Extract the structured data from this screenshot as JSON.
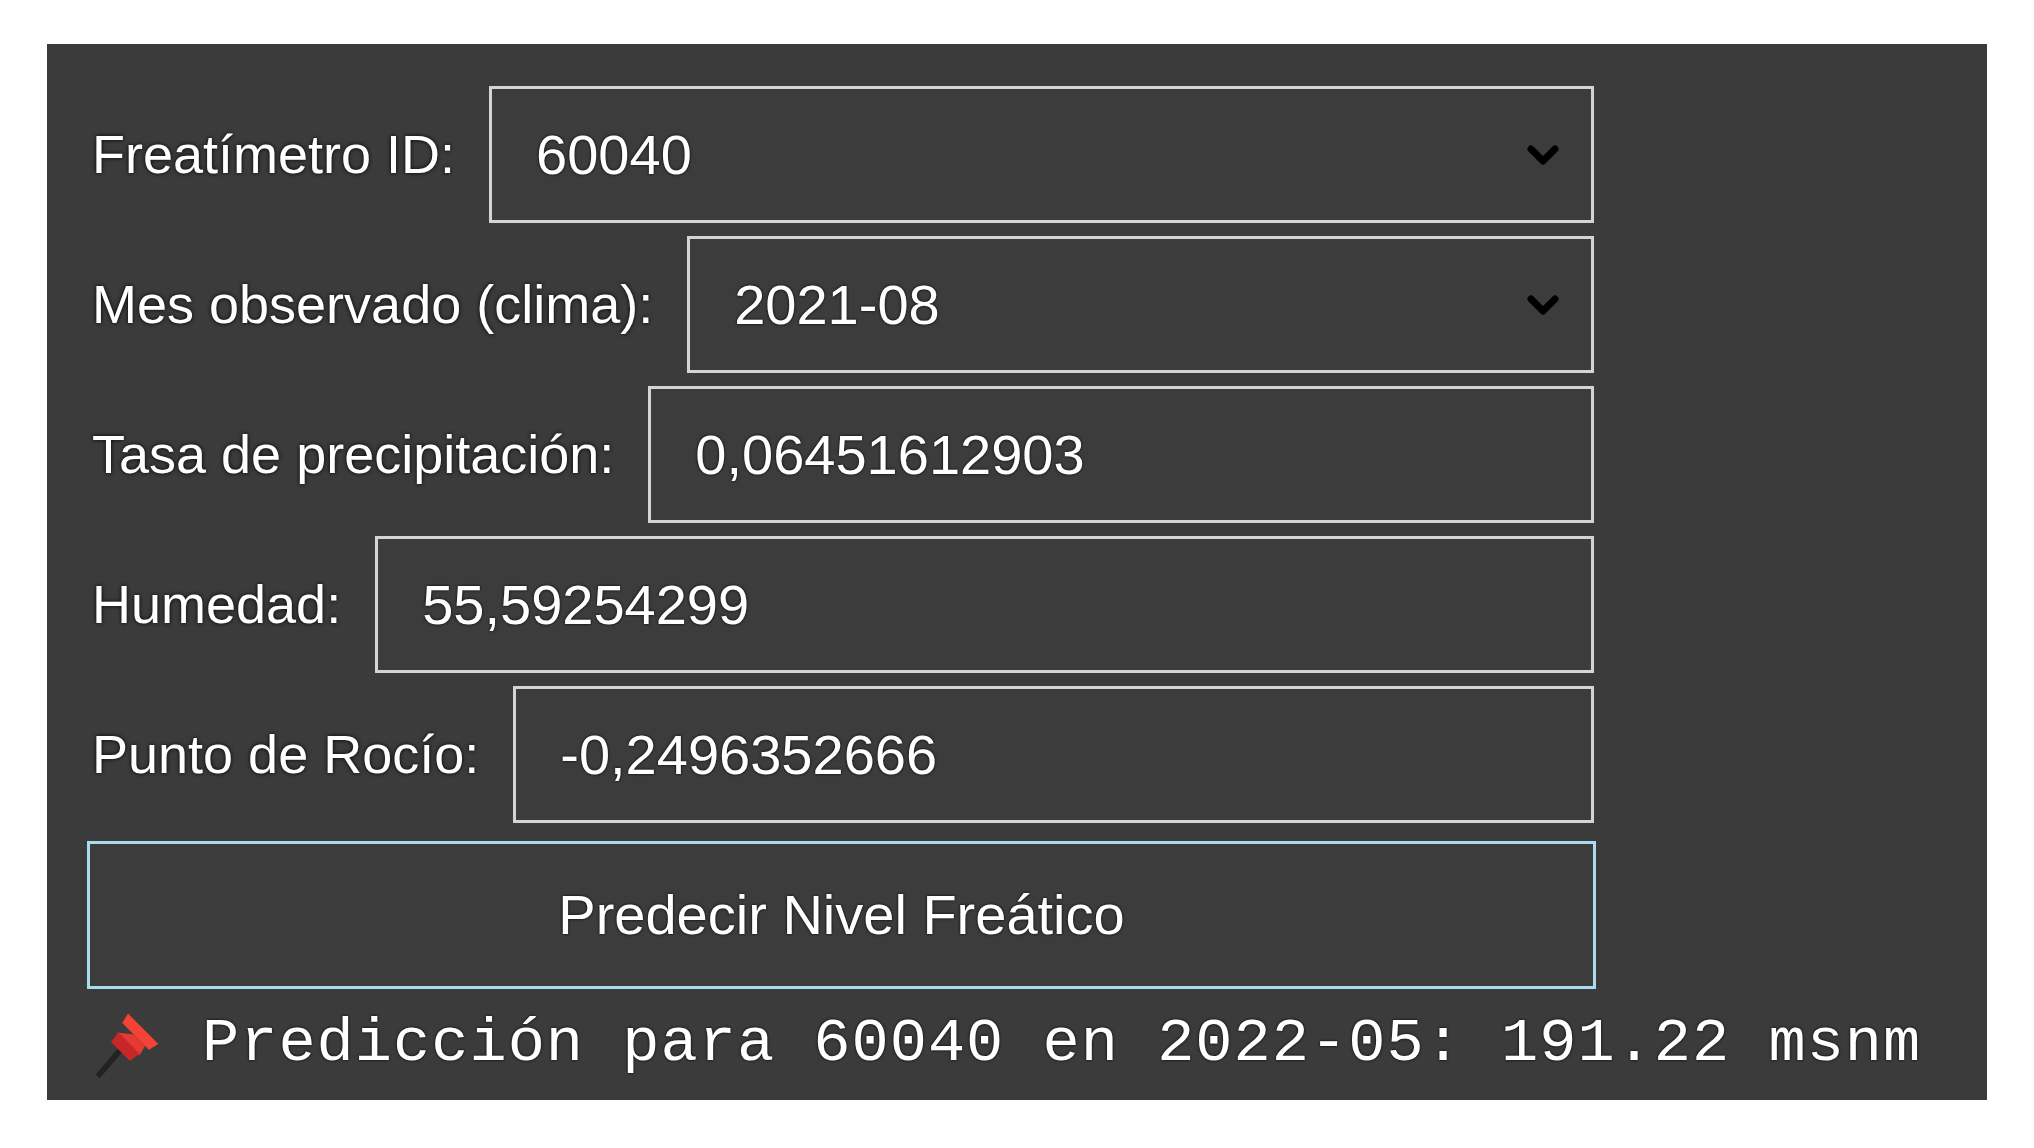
{
  "fields": [
    {
      "kind": "select",
      "label": "Freatímetro ID:",
      "value": "60040"
    },
    {
      "kind": "select",
      "label": "Mes observado (clima):",
      "value": "2021-08"
    },
    {
      "kind": "input",
      "label": "Tasa de precipitación:",
      "value": "0,06451612903"
    },
    {
      "kind": "input",
      "label": "Humedad:",
      "value": "55,59254299"
    },
    {
      "kind": "input",
      "label": "Punto de Rocío:",
      "value": "-0,2496352666"
    }
  ],
  "button": "Predecir Nivel Freático",
  "result": "Predicción para 60040 en 2022-05: 191.22 msnm"
}
